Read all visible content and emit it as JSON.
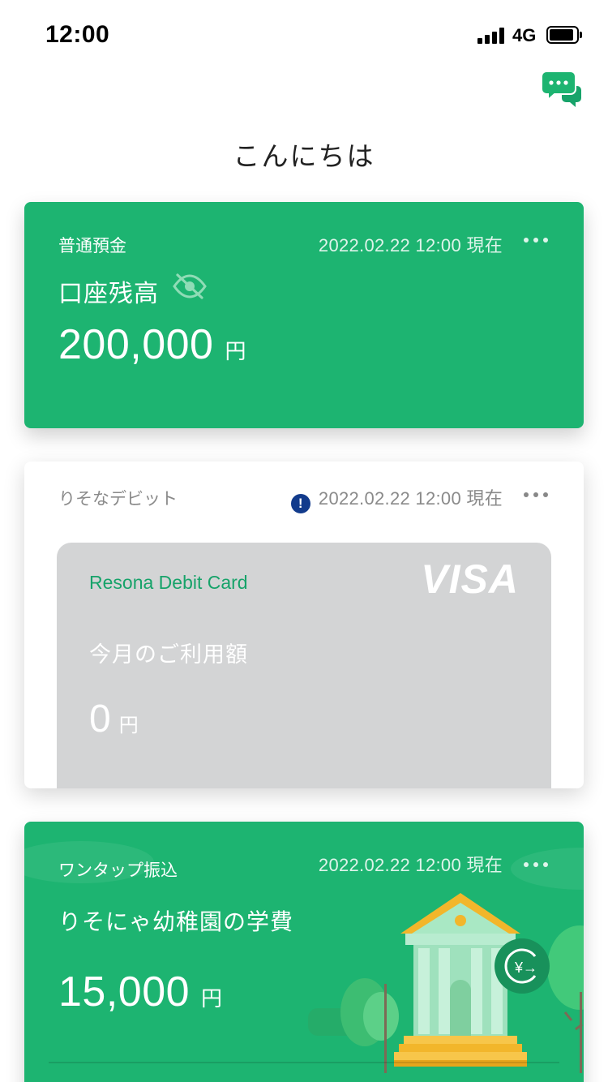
{
  "status_bar": {
    "time": "12:00",
    "network": "4G"
  },
  "greeting": "こんにちは",
  "savings": {
    "label": "普通預金",
    "date": "2022.02.22 12:00 現在",
    "title": "口座残高",
    "amount": "200,000",
    "currency": "円"
  },
  "debit": {
    "label": "りそなデビット",
    "warning_icon": "!",
    "date": "2022.02.22 12:00 現在",
    "card_name": "Resona Debit Card",
    "brand": "VISA",
    "usage_label": "今月のご利用額",
    "amount": "0",
    "currency": "円"
  },
  "onetap": {
    "label": "ワンタップ振込",
    "date": "2022.02.22 12:00 現在",
    "title": "りそにゃ幼稚園の学費",
    "amount": "15,000",
    "currency": "円",
    "transfer_icon_text": "¥→"
  },
  "icons": {
    "chat": "chat-icon",
    "eye": "eye-off-icon",
    "more": "more-dots-icon",
    "transfer": "yen-transfer-icon"
  },
  "colors": {
    "brand_green": "#1db471",
    "card_gray": "#d3d4d5",
    "warning_blue": "#123b8c",
    "bank_gold": "#f2b62b"
  }
}
